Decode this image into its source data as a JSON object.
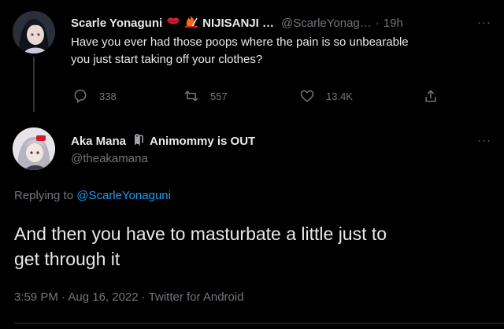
{
  "tweet1": {
    "display_name": "Scarle Yonaguni",
    "org": "NIJISANJI …",
    "handle": "@ScarleYonag…",
    "sep": "·",
    "time": "19h",
    "more": "···",
    "text_line1": "Have you ever had those poops where the pain is so unbearable",
    "text_line2": "you just start taking off your clothes?",
    "reply_count": "338",
    "retweet_count": "557",
    "like_count": "13.4K"
  },
  "tweet2": {
    "display_name_part1": "Aka Mana",
    "display_name_part2": "Animommy is OUT",
    "handle": "@theakamana",
    "more": "···",
    "replying_prefix": "Replying to",
    "replying_to": "@ScarleYonaguni",
    "text_line1": "And then you have to masturbate a little just to",
    "text_line2": "get through it",
    "meta": "3:59 PM · Aug 16, 2022 · Twitter for Android"
  },
  "colors": {
    "background": "#000000",
    "text": "#e7e9ea",
    "muted": "#71767b",
    "link": "#1d9bf0"
  },
  "icons": [
    "lips-emoji",
    "flame-chart-emoji",
    "paperclip-emoji",
    "reply-icon",
    "retweet-icon",
    "like-icon",
    "share-icon"
  ]
}
